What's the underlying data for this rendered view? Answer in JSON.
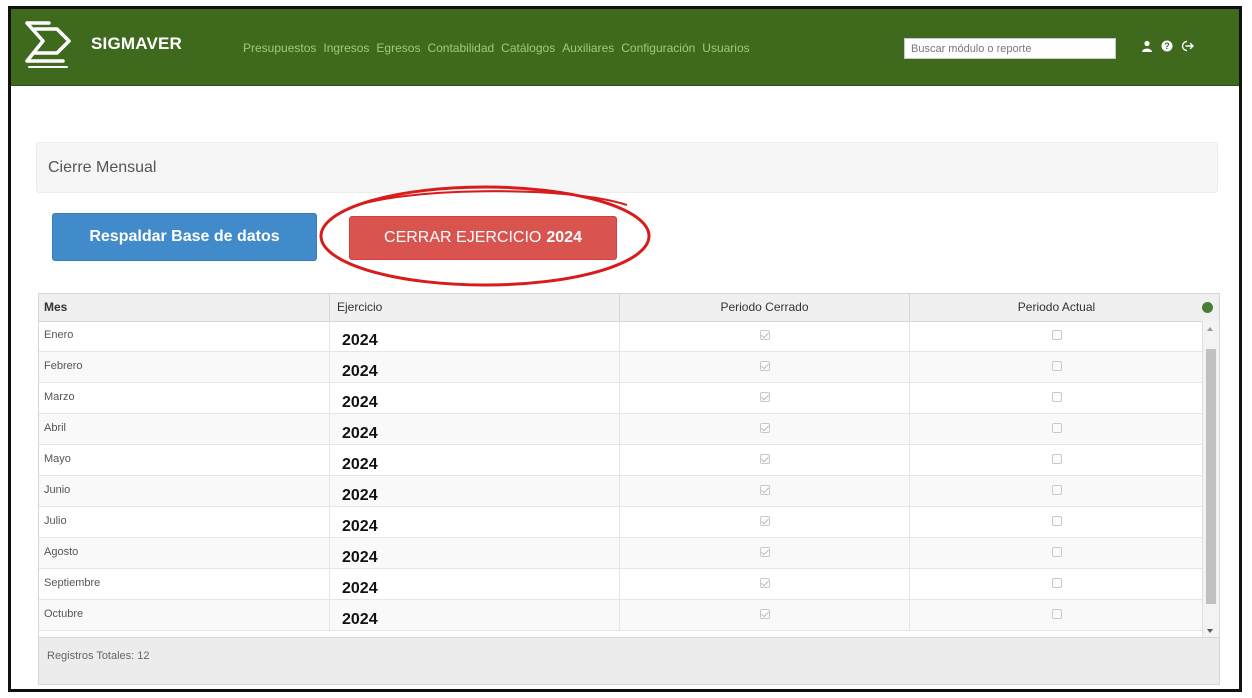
{
  "app": {
    "name": "SIGMAVER"
  },
  "nav": {
    "menu": [
      "Presupuestos",
      "Ingresos",
      "Egresos",
      "Contabilidad",
      "Catálogos",
      "Auxiliares",
      "Configuración",
      "Usuarios"
    ],
    "search_placeholder": "Buscar módulo o reporte",
    "icons": [
      "user-icon",
      "help-icon",
      "logout-icon"
    ],
    "color": "#3f6a1e"
  },
  "panel": {
    "title": "Cierre Mensual"
  },
  "actions": {
    "backup_label": "Respaldar Base de datos",
    "close_label": "CERRAR EJERCICIO",
    "close_year": "2024",
    "backup_color": "#428bca",
    "close_color": "#d9534f",
    "annotation_color": "#d81b1b"
  },
  "grid": {
    "columns": [
      "Mes",
      "Ejercicio",
      "Periodo Cerrado",
      "Periodo Actual"
    ],
    "rows": [
      {
        "mes": "Enero",
        "ejercicio": "2024",
        "cerrado": true,
        "actual": false
      },
      {
        "mes": "Febrero",
        "ejercicio": "2024",
        "cerrado": true,
        "actual": false
      },
      {
        "mes": "Marzo",
        "ejercicio": "2024",
        "cerrado": true,
        "actual": false
      },
      {
        "mes": "Abril",
        "ejercicio": "2024",
        "cerrado": true,
        "actual": false
      },
      {
        "mes": "Mayo",
        "ejercicio": "2024",
        "cerrado": true,
        "actual": false
      },
      {
        "mes": "Junio",
        "ejercicio": "2024",
        "cerrado": true,
        "actual": false
      },
      {
        "mes": "Julio",
        "ejercicio": "2024",
        "cerrado": true,
        "actual": false
      },
      {
        "mes": "Agosto",
        "ejercicio": "2024",
        "cerrado": true,
        "actual": false
      },
      {
        "mes": "Septiembre",
        "ejercicio": "2024",
        "cerrado": true,
        "actual": false
      },
      {
        "mes": "Octubre",
        "ejercicio": "2024",
        "cerrado": true,
        "actual": false
      }
    ],
    "footer": "Registros Totales: 12"
  }
}
